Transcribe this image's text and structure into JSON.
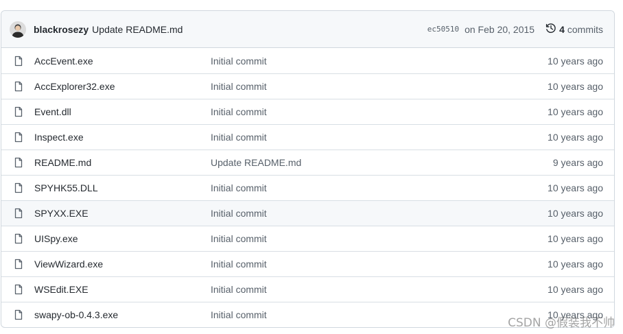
{
  "latest_commit": {
    "author": "blackrosezy",
    "message": "Update README.md",
    "sha": "ec50510",
    "date": "on Feb 20, 2015",
    "commit_count": "4",
    "commits_label": "commits",
    "avatar_icon": "user-avatar",
    "history_icon": "history-icon"
  },
  "files": [
    {
      "name": "AccEvent.exe",
      "commit": "Initial commit",
      "age": "10 years ago"
    },
    {
      "name": "AccExplorer32.exe",
      "commit": "Initial commit",
      "age": "10 years ago"
    },
    {
      "name": "Event.dll",
      "commit": "Initial commit",
      "age": "10 years ago"
    },
    {
      "name": "Inspect.exe",
      "commit": "Initial commit",
      "age": "10 years ago"
    },
    {
      "name": "README.md",
      "commit": "Update README.md",
      "age": "9 years ago"
    },
    {
      "name": "SPYHK55.DLL",
      "commit": "Initial commit",
      "age": "10 years ago"
    },
    {
      "name": "SPYXX.EXE",
      "commit": "Initial commit",
      "age": "10 years ago"
    },
    {
      "name": "UISpy.exe",
      "commit": "Initial commit",
      "age": "10 years ago"
    },
    {
      "name": "ViewWizard.exe",
      "commit": "Initial commit",
      "age": "10 years ago"
    },
    {
      "name": "WSEdit.EXE",
      "commit": "Initial commit",
      "age": "10 years ago"
    },
    {
      "name": "swapy-ob-0.4.3.exe",
      "commit": "Initial commit",
      "age": "10 years ago"
    }
  ],
  "file_icon": "file-icon",
  "watermark": "CSDN @假装我不帅",
  "colors": {
    "border": "#d0d7de",
    "header_bg": "#f6f8fa",
    "text_primary": "#24292f",
    "text_muted": "#57606a"
  }
}
